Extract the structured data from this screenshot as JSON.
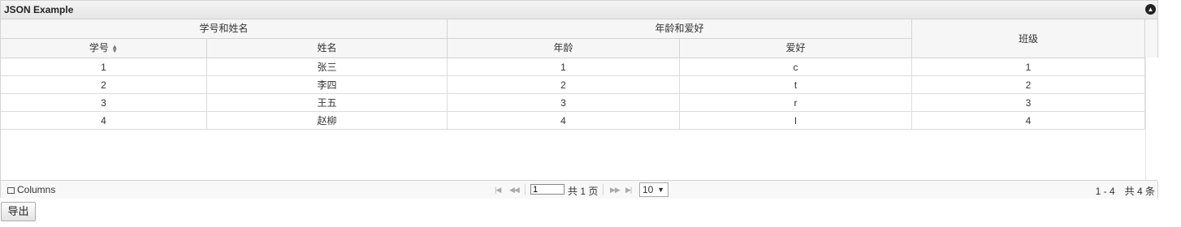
{
  "grid": {
    "title": "JSON Example"
  },
  "header": {
    "groups": [
      "学号和姓名",
      "年龄和爱好"
    ],
    "columns": [
      "学号",
      "姓名",
      "年龄",
      "爱好",
      "班级"
    ],
    "sort_icon": "sort-icon"
  },
  "rows": [
    [
      "1",
      "张三",
      "1",
      "c",
      "1"
    ],
    [
      "2",
      "李四",
      "2",
      "t",
      "2"
    ],
    [
      "3",
      "王五",
      "3",
      "r",
      "3"
    ],
    [
      "4",
      "赵柳",
      "4",
      "l",
      "4"
    ]
  ],
  "pager": {
    "columns_label": "Columns",
    "current_page": "1",
    "total_pages_label": "共 1 页",
    "rows_per_page": "10",
    "summary": "1 - 4　共 4 条"
  },
  "export_label": "导出"
}
